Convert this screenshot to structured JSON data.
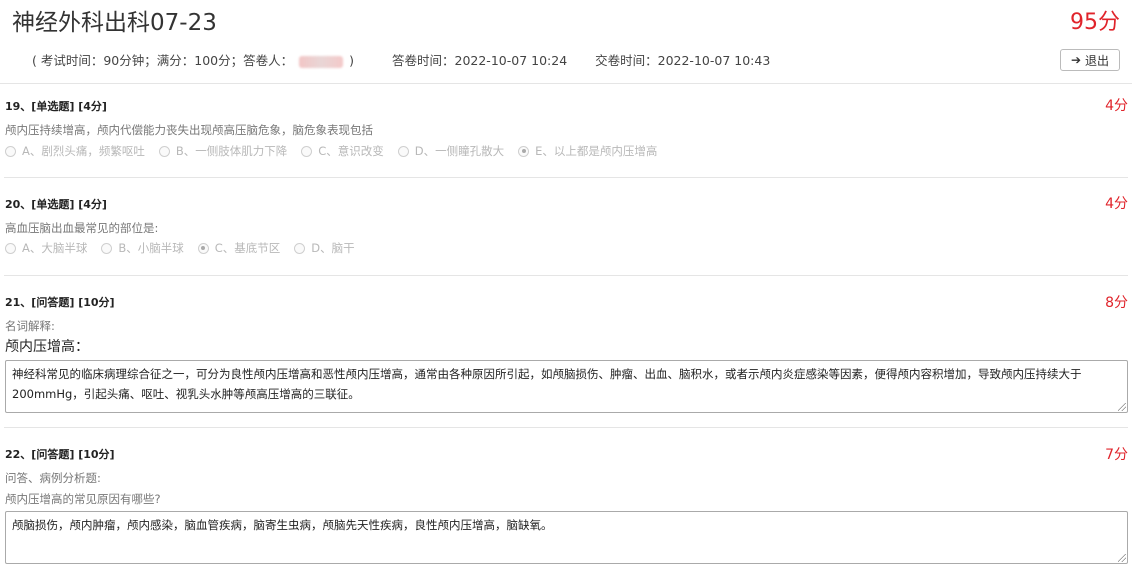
{
  "exam": {
    "title": "神经外科出科07-23",
    "total_score": "95分",
    "meta_prefix": "( 考试时间：90分钟；满分：100分；答卷人：",
    "meta_suffix": ")",
    "answer_time": "答卷时间：2022-10-07 10:24",
    "submit_time": "交卷时间：2022-10-07 10:43",
    "exit_label": "退出",
    "exit_icon": "arrow-right-icon"
  },
  "questions": [
    {
      "head": "19、[单选题] [4分]",
      "score": "4分",
      "stem": "颅内压持续增高，颅内代偿能力丧失出现颅高压脑危象，脑危象表现包括",
      "options": [
        {
          "label": "A、剧烈头痛，频繁呕吐",
          "checked": false
        },
        {
          "label": "B、一侧肢体肌力下降",
          "checked": false
        },
        {
          "label": "C、意识改变",
          "checked": false
        },
        {
          "label": "D、一侧瞳孔散大",
          "checked": false
        },
        {
          "label": "E、以上都是颅内压增高",
          "checked": true
        }
      ]
    },
    {
      "head": "20、[单选题] [4分]",
      "score": "4分",
      "stem": "高血压脑出血最常见的部位是:",
      "options": [
        {
          "label": "A、大脑半球",
          "checked": false
        },
        {
          "label": "B、小脑半球",
          "checked": false
        },
        {
          "label": "C、基底节区",
          "checked": true
        },
        {
          "label": "D、脑干",
          "checked": false
        }
      ]
    },
    {
      "head": "21、[问答题] [10分]",
      "score": "8分",
      "stem": "名词解释:",
      "subtitle": "颅内压增高：",
      "answer": "神经科常见的临床病理综合征之一，可分为良性颅内压增高和恶性颅内压增高，通常由各种原因所引起，如颅脑损伤、肿瘤、出血、脑积水，或者示颅内炎症感染等因素，便得颅内容积增加，导致颅内压持续大于200mmHg，引起头痛、呕吐、视乳头水肿等颅高压增高的三联征。"
    },
    {
      "head": "22、[问答题] [10分]",
      "score": "7分",
      "stem": "问答、病例分析题:",
      "stem2": "颅内压增高的常见原因有哪些?",
      "answer": "颅脑损伤，颅内肿瘤，颅内感染，脑血管疾病，脑寄生虫病，颅脑先天性疾病，良性颅内压增高，脑缺氧。"
    }
  ]
}
